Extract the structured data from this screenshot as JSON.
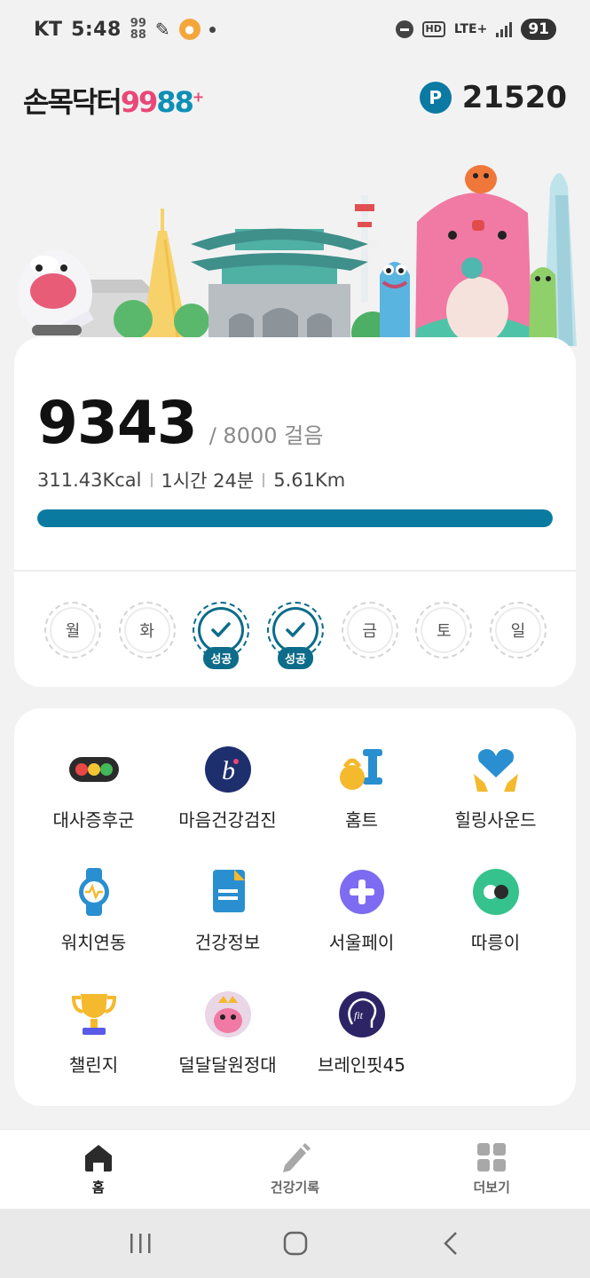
{
  "status_bar": {
    "carrier": "KT",
    "time": "5:48",
    "network": "LTE+",
    "battery": "91"
  },
  "header": {
    "logo_korean": "손목닥터",
    "logo_99": "99",
    "logo_88": "88",
    "logo_plus": "+",
    "points_icon_letter": "P",
    "points_value": "21520"
  },
  "steps": {
    "value": "9343",
    "goal_text": "/ 8000 걸음",
    "kcal": "311.43Kcal",
    "duration": "1시간 24분",
    "distance": "5.61Km",
    "progress_fraction": 1.0,
    "days": [
      {
        "label": "월",
        "success": false
      },
      {
        "label": "화",
        "success": false
      },
      {
        "label": "",
        "success": true,
        "badge": "성공"
      },
      {
        "label": "",
        "success": true,
        "badge": "성공"
      },
      {
        "label": "금",
        "success": false
      },
      {
        "label": "토",
        "success": false
      },
      {
        "label": "일",
        "success": false
      }
    ]
  },
  "menu": {
    "items": [
      {
        "label": "대사증후군",
        "icon": "traffic-light-icon"
      },
      {
        "label": "마음건강검진",
        "icon": "mind-b-icon"
      },
      {
        "label": "홈트",
        "icon": "kettlebell-dumbbell-icon"
      },
      {
        "label": "힐링사운드",
        "icon": "heart-hands-icon"
      },
      {
        "label": "워치연동",
        "icon": "smartwatch-icon"
      },
      {
        "label": "건강정보",
        "icon": "document-icon"
      },
      {
        "label": "서울페이",
        "icon": "plus-circle-icon"
      },
      {
        "label": "따릉이",
        "icon": "bike-toggle-icon"
      },
      {
        "label": "챌린지",
        "icon": "trophy-icon"
      },
      {
        "label": "덜달달원정대",
        "icon": "character-avatar-icon"
      },
      {
        "label": "브레인핏45",
        "icon": "brain-fit-icon"
      }
    ]
  },
  "bottom_nav": {
    "home": "홈",
    "record": "건강기록",
    "more": "더보기"
  },
  "colors": {
    "primary": "#0a7aa0",
    "pink": "#e84877",
    "background": "#f2f2f3"
  }
}
